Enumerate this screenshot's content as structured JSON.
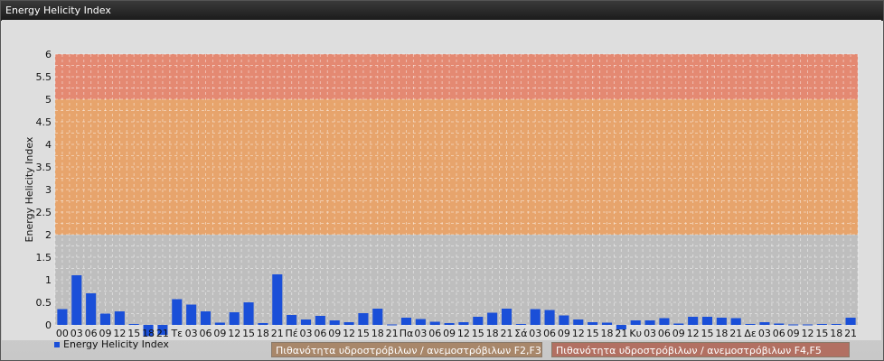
{
  "window": {
    "title": "Energy Helicity Index"
  },
  "chart_data": {
    "type": "bar",
    "title": "",
    "ylabel": "Energy Helicity Index",
    "xlabel": "",
    "ylim": [
      0,
      6
    ],
    "yticks": [
      "0",
      "0.5",
      "1",
      "1.5",
      "2",
      "2.5",
      "3",
      "3.5",
      "4",
      "4.5",
      "5",
      "5.5",
      "6"
    ],
    "series": [
      {
        "name": "Energy Helicity Index",
        "color": "#1a4fd8"
      }
    ],
    "categories": [
      "00",
      "03",
      "06",
      "09",
      "12",
      "15",
      "18",
      "21",
      "Τε",
      "03",
      "06",
      "09",
      "12",
      "15",
      "18",
      "21",
      "Πέ",
      "03",
      "06",
      "09",
      "12",
      "15",
      "18",
      "21",
      "Πα",
      "03",
      "06",
      "09",
      "12",
      "15",
      "18",
      "21",
      "Σά",
      "03",
      "06",
      "09",
      "12",
      "15",
      "18",
      "21",
      "Κυ",
      "03",
      "06",
      "09",
      "12",
      "15",
      "18",
      "21",
      "Δε",
      "03",
      "06",
      "09",
      "12",
      "15",
      "18",
      "21"
    ],
    "values": [
      0.35,
      1.1,
      0.7,
      0.25,
      0.3,
      0.02,
      -0.25,
      -0.22,
      0.57,
      0.45,
      0.3,
      0.05,
      0.28,
      0.5,
      0.04,
      1.12,
      0.22,
      0.12,
      0.2,
      0.1,
      0.06,
      0.26,
      0.36,
      0.01,
      0.16,
      0.13,
      0.07,
      0.04,
      0.06,
      0.18,
      0.27,
      0.36,
      0.02,
      0.35,
      0.33,
      0.21,
      0.12,
      0.06,
      0.05,
      -0.1,
      0.1,
      0.1,
      0.15,
      0.03,
      0.18,
      0.18,
      0.16,
      0.15,
      0.02,
      0.06,
      0.03,
      0.01,
      0.01,
      0.02,
      0.02,
      0.16
    ],
    "bands": [
      {
        "from": 0,
        "to": 2,
        "color": "#bebebe",
        "label": ""
      },
      {
        "from": 2,
        "to": 5,
        "color": "#e7a46c",
        "label": "Πιθανότητα υδροστρόβιλων / ανεμοστρόβιλων F2,F3"
      },
      {
        "from": 5,
        "to": 6,
        "color": "#e48972",
        "label": "Πιθανότητα υδροστρόβιλων / ανεμοστρόβιλων F4,F5"
      }
    ],
    "grid": true,
    "legend_position": "bottom-left"
  }
}
